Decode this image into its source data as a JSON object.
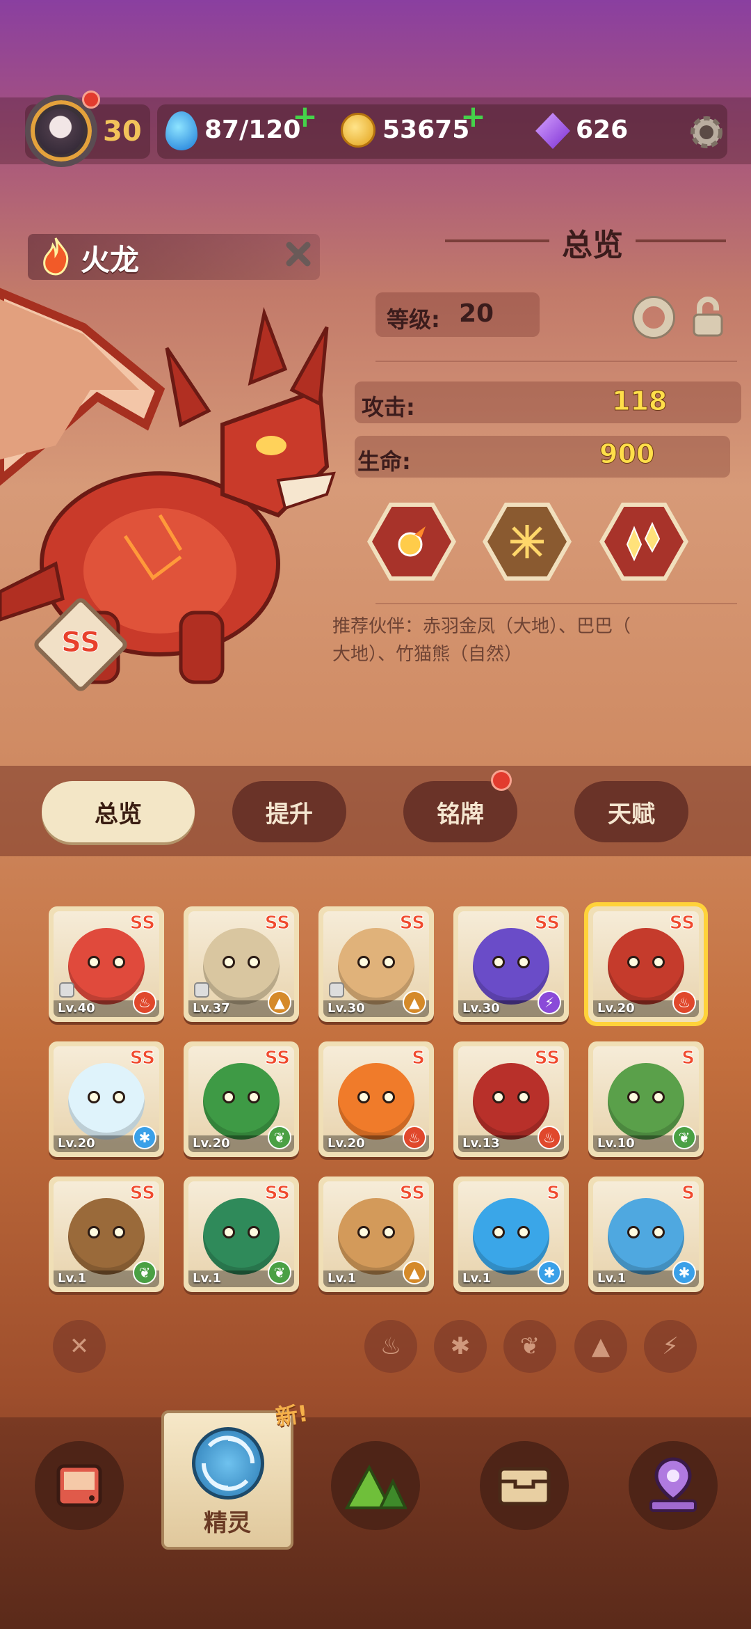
{
  "header": {
    "player_level": "30",
    "stamina": "87/120",
    "coins": "53675",
    "gems": "626"
  },
  "pet": {
    "name": "火龙",
    "rank": "SS",
    "panel_title": "总览",
    "level_label": "等级:",
    "level_value": "20",
    "attack_label": "攻击:",
    "attack_value": "118",
    "hp_label": "生命:",
    "hp_value": "900",
    "recommend_line1": "推荐伙伴：赤羽金凤（大地）、巴巴（",
    "recommend_line2": "大地）、竹猫熊（自然）"
  },
  "tabs": [
    "总览",
    "提升",
    "铭牌",
    "天赋"
  ],
  "collection": [
    {
      "rank": "SS",
      "level": "Lv.40",
      "element": "fire",
      "color": "#e04a3c",
      "locked": true
    },
    {
      "rank": "SS",
      "level": "Lv.37",
      "element": "earth",
      "color": "#d9c6a0",
      "locked": true
    },
    {
      "rank": "SS",
      "level": "Lv.30",
      "element": "earth",
      "color": "#e0b27a",
      "locked": true
    },
    {
      "rank": "SS",
      "level": "Lv.30",
      "element": "thunder",
      "color": "#6a4cc8",
      "locked": false
    },
    {
      "rank": "SS",
      "level": "Lv.20",
      "element": "fire",
      "color": "#c53b2c",
      "locked": false,
      "selected": true
    },
    {
      "rank": "SS",
      "level": "Lv.20",
      "element": "ice",
      "color": "#dff3fb",
      "locked": false
    },
    {
      "rank": "SS",
      "level": "Lv.20",
      "element": "nature",
      "color": "#3e9a45",
      "locked": false
    },
    {
      "rank": "S",
      "level": "Lv.20",
      "element": "fire",
      "color": "#f07b2a",
      "locked": false
    },
    {
      "rank": "SS",
      "level": "Lv.13",
      "element": "fire",
      "color": "#b8302a",
      "locked": false
    },
    {
      "rank": "S",
      "level": "Lv.10",
      "element": "nature",
      "color": "#5aa04a",
      "locked": false
    },
    {
      "rank": "SS",
      "level": "Lv.1",
      "element": "nature",
      "color": "#9a6a3a",
      "locked": false
    },
    {
      "rank": "SS",
      "level": "Lv.1",
      "element": "nature",
      "color": "#2f8a5a",
      "locked": false
    },
    {
      "rank": "SS",
      "level": "Lv.1",
      "element": "earth",
      "color": "#d39a5a",
      "locked": false
    },
    {
      "rank": "S",
      "level": "Lv.1",
      "element": "ice",
      "color": "#3aa6e8",
      "locked": false
    },
    {
      "rank": "S",
      "level": "Lv.1",
      "element": "ice",
      "color": "#4fa8e0",
      "locked": false
    }
  ],
  "element_colors": {
    "fire": "#e0482c",
    "earth": "#d58a2a",
    "thunder": "#8a4ad8",
    "ice": "#3aa0e8",
    "nature": "#4aa044"
  },
  "element_glyphs": {
    "fire": "♨",
    "earth": "▲",
    "thunder": "⚡",
    "ice": "✱",
    "nature": "❦"
  },
  "nav": {
    "new_badge": "新!",
    "active_label": "精灵"
  },
  "colors": {
    "accent_yellow": "#ffdf4a",
    "rank_red": "#f04a2e",
    "tab_active": "#f3e6c6"
  }
}
